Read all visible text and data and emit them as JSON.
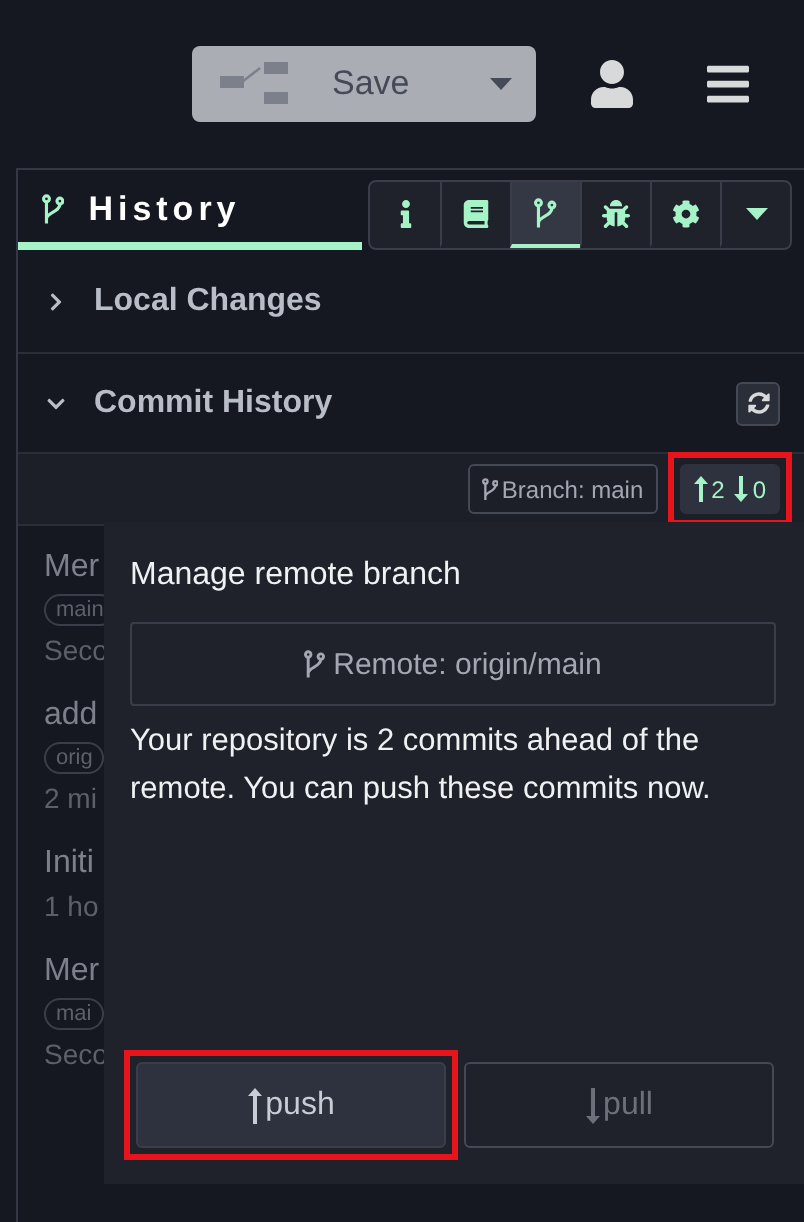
{
  "toolbar": {
    "save_label": "Save"
  },
  "sidebar": {
    "title": "History",
    "tools": [
      {
        "kind": "info",
        "selected": false
      },
      {
        "kind": "book",
        "selected": false
      },
      {
        "kind": "branch",
        "selected": true
      },
      {
        "kind": "bug",
        "selected": false
      },
      {
        "kind": "settings",
        "selected": false
      },
      {
        "kind": "menu",
        "selected": false
      }
    ]
  },
  "sections": [
    {
      "title": "Local Changes",
      "expanded": false
    },
    {
      "title": "Commit History",
      "expanded": true
    }
  ],
  "branch_bar": {
    "branch_label": "Branch: main",
    "ahead": "2",
    "behind": "0",
    "highlighted": true
  },
  "commits": [
    {
      "message": "Mer",
      "tag": "main",
      "time": "Seco"
    },
    {
      "message": "add",
      "tag": "orig",
      "time": "2 mi"
    },
    {
      "message": "Initi",
      "time": "1 ho"
    },
    {
      "message": "Mer",
      "tag": "mai",
      "time": "Seco"
    }
  ],
  "popover": {
    "title": "Manage remote branch",
    "remote_label": "Remote: origin/main",
    "message": "Your repository is 2 commits ahead of the remote. You can push these commits now.",
    "buttons": [
      {
        "kind": "push",
        "label": "push",
        "highlighted": true
      },
      {
        "kind": "pull",
        "label": "pull",
        "highlighted": false
      }
    ]
  }
}
